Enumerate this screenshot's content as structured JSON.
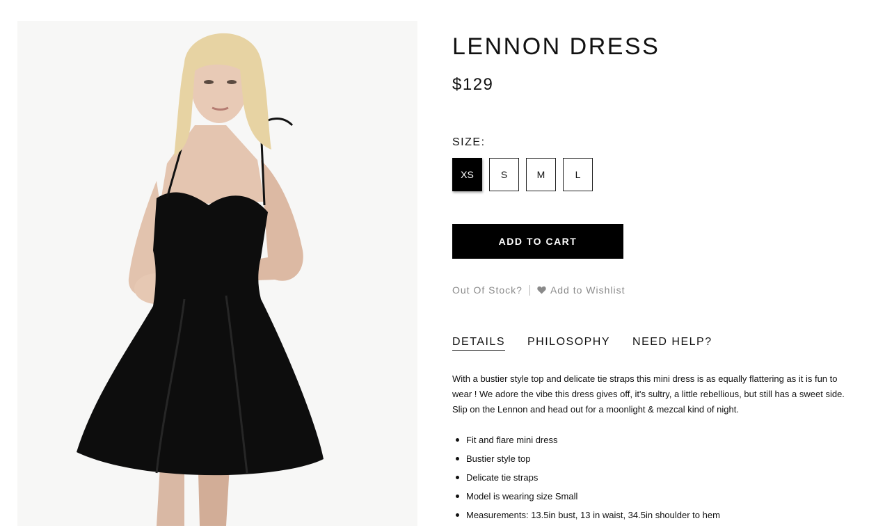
{
  "product": {
    "title": "LENNON DRESS",
    "price": "$129",
    "image_alt": "Model wearing black bustier mini dress"
  },
  "size": {
    "label": "SIZE:",
    "options": [
      "XS",
      "S",
      "M",
      "L"
    ],
    "selected": "XS"
  },
  "actions": {
    "add_to_cart": "ADD TO CART",
    "out_of_stock": "Out Of Stock?",
    "wishlist": "Add to Wishlist",
    "wishlist_icon": "heart-icon"
  },
  "tabs": [
    {
      "label": "DETAILS",
      "active": true
    },
    {
      "label": "PHILOSOPHY",
      "active": false
    },
    {
      "label": "NEED HELP?",
      "active": false
    }
  ],
  "details": {
    "description": "With a bustier style top and delicate tie straps this mini dress is as equally flattering as it is fun to wear !  We adore the vibe this dress gives off, it's sultry, a little rebellious, but still has a sweet side. Slip on the Lennon and head out for a moonlight & mezcal kind of night.",
    "bullets": [
      "Fit and flare mini dress",
      "Bustier style top",
      "Delicate tie straps",
      "Model is wearing size Small",
      "Measurements: 13.5in bust, 13 in waist, 34.5in shoulder to hem"
    ]
  },
  "colors": {
    "primary": "#000000",
    "muted_text": "#8a8a8a",
    "image_background": "#f7f7f6"
  }
}
